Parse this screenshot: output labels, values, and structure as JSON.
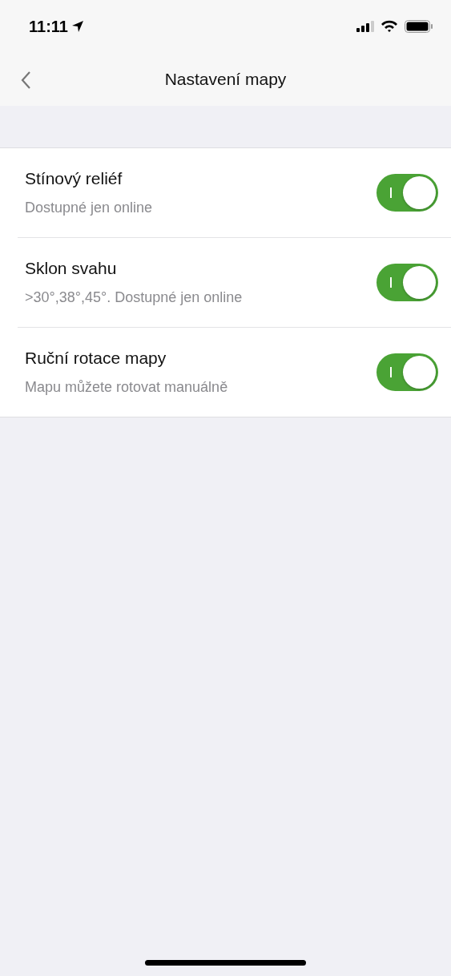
{
  "status_bar": {
    "time": "11:11"
  },
  "nav": {
    "title": "Nastavení mapy"
  },
  "settings": [
    {
      "title": "Stínový reliéf",
      "subtitle": "Dostupné jen online",
      "on": true
    },
    {
      "title": "Sklon svahu",
      "subtitle": ">30°,38°,45°. Dostupné jen online",
      "on": true
    },
    {
      "title": "Ruční rotace mapy",
      "subtitle": "Mapu můžete rotovat manuálně",
      "on": true
    }
  ]
}
